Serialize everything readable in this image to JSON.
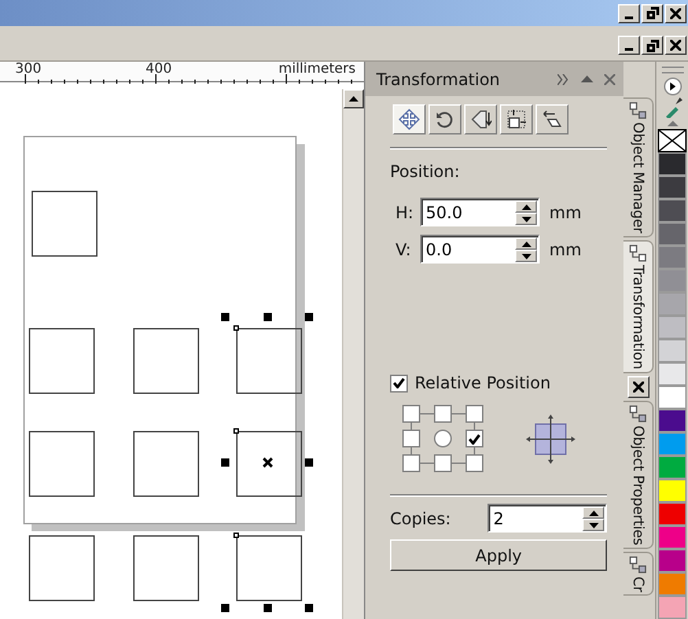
{
  "ruler": {
    "labels": [
      "300",
      "400"
    ],
    "unit": "millimeters"
  },
  "docker": {
    "title": "Transformation",
    "tools": [
      {
        "kind": "position",
        "selected": true
      },
      {
        "kind": "rotate",
        "selected": false
      },
      {
        "kind": "scale",
        "selected": false
      },
      {
        "kind": "size",
        "selected": false
      },
      {
        "kind": "skew",
        "selected": false
      }
    ],
    "section_label": "Position:",
    "fields": [
      {
        "label": "H:",
        "value": "50.0",
        "unit": "mm"
      },
      {
        "label": "V:",
        "value": "0.0",
        "unit": "mm"
      }
    ],
    "relative_position": {
      "label": "Relative Position",
      "checked": true
    },
    "anchors": [
      {
        "kind": "box",
        "selected": false
      },
      {
        "kind": "box",
        "selected": false
      },
      {
        "kind": "box",
        "selected": false
      },
      {
        "kind": "box",
        "selected": false
      },
      {
        "kind": "center",
        "selected": false
      },
      {
        "kind": "box",
        "selected": true
      },
      {
        "kind": "box",
        "selected": false
      },
      {
        "kind": "box",
        "selected": false
      },
      {
        "kind": "box",
        "selected": false
      }
    ],
    "copies": {
      "label": "Copies:",
      "value": "2"
    },
    "apply": "Apply"
  },
  "side_tabs": [
    {
      "label": "Object Manager",
      "selected": false
    },
    {
      "label": "Transformation",
      "selected": true
    },
    {
      "label": "Object Properties",
      "selected": false
    },
    {
      "label": "Cr",
      "selected": false
    }
  ],
  "palette": [
    {
      "color": "#2a2a2e"
    },
    {
      "color": "#3c3b40"
    },
    {
      "color": "#4e4d53"
    },
    {
      "color": "#66656b"
    },
    {
      "color": "#7c7b81"
    },
    {
      "color": "#908f95"
    },
    {
      "color": "#a7a6ab"
    },
    {
      "color": "#bebdc2"
    },
    {
      "color": "#d3d3d6"
    },
    {
      "color": "#e8e8ea"
    },
    {
      "color": "#ffffff"
    },
    {
      "color": "#4b0c8e"
    },
    {
      "color": "#009cee"
    },
    {
      "color": "#00ab40"
    },
    {
      "color": "#ffff00"
    },
    {
      "color": "#ee0000"
    },
    {
      "color": "#ee0088"
    },
    {
      "color": "#b8008a"
    },
    {
      "color": "#ef7b00"
    },
    {
      "color": "#f4a4b4"
    }
  ]
}
